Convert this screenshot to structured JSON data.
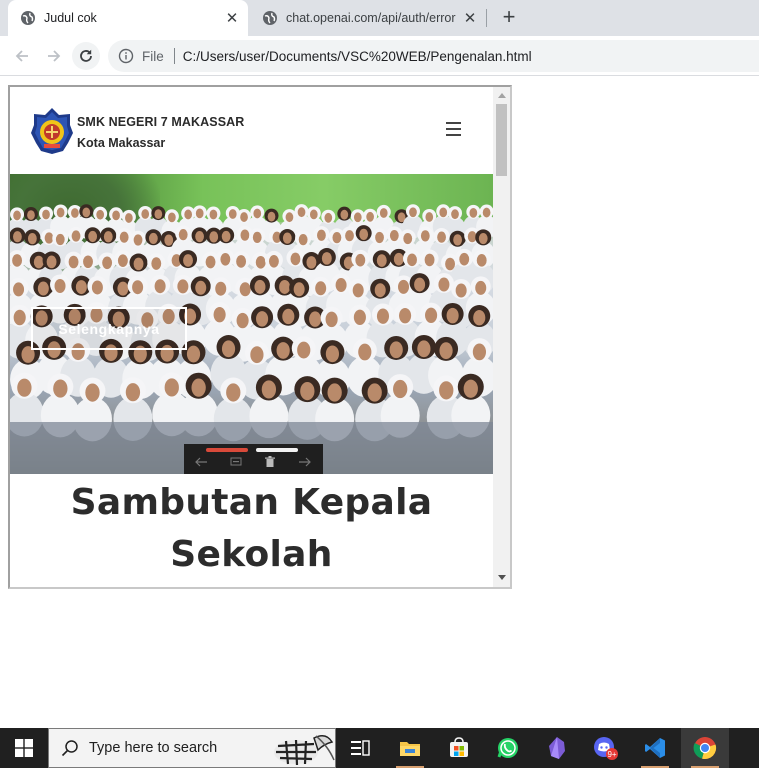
{
  "browser": {
    "tabs": [
      {
        "title": "Judul cok",
        "active": true
      },
      {
        "title": "chat.openai.com/api/auth/error",
        "active": false
      }
    ],
    "address": {
      "scheme": "File",
      "url": "C:/Users/user/Documents/VSC%20WEB/Pengenalan.html"
    }
  },
  "site": {
    "brand": {
      "name": "SMK NEGERI 7 MAKASSAR",
      "city": "Kota Makassar"
    },
    "hero": {
      "button_label": "Selengkapnya",
      "active_slide": 1,
      "slide_count": 2
    },
    "heading_line1": "Sambutan Kepala",
    "heading_line2": "Sekolah"
  },
  "taskbar": {
    "search_placeholder": "Type here to search",
    "pinned": [
      "task-view",
      "file-explorer",
      "microsoft-store",
      "whatsapp",
      "obsidian",
      "discord",
      "vscode",
      "chrome"
    ],
    "discord_badge": "9+"
  },
  "colors": {
    "accent_red": "#d94a3a",
    "taskbar": "#202020",
    "tabstrip": "#dee1e6"
  }
}
